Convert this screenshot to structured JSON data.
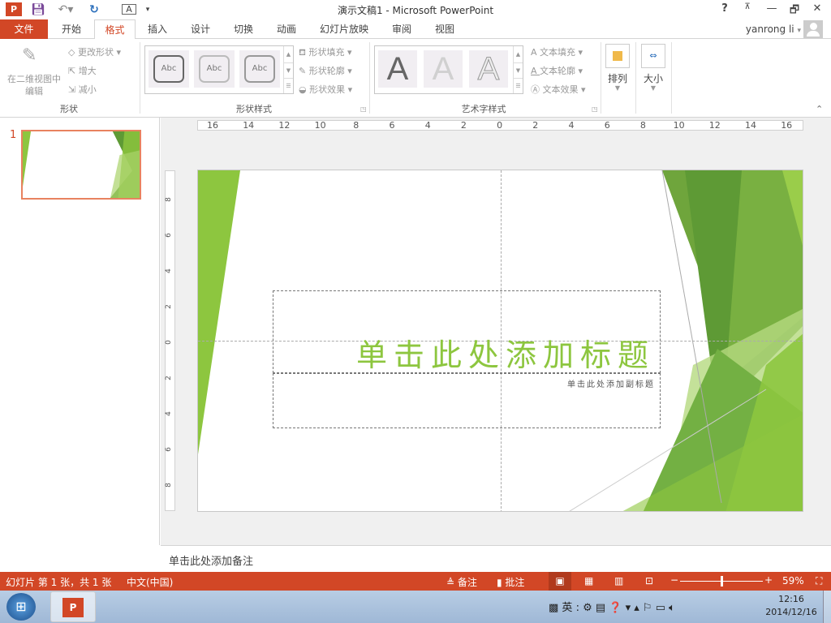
{
  "window": {
    "title": "演示文稿1 - Microsoft PowerPoint",
    "help": "?",
    "restore_ribbon": "⊼",
    "minimize": "—",
    "maximize": "🗗",
    "close": "✕"
  },
  "quick_access": {
    "app_icon": "P",
    "save_icon": "save-icon",
    "undo_icon": "undo-icon",
    "redo_icon": "redo-icon",
    "layout_icon": "layout-icon",
    "customize": "▾"
  },
  "tabs": [
    "文件",
    "开始",
    "格式",
    "插入",
    "设计",
    "切换",
    "动画",
    "幻灯片放映",
    "审阅",
    "视图"
  ],
  "user": {
    "name": "yanrong li",
    "caret": "▾"
  },
  "ribbon": {
    "shape_group": {
      "edit_2d": "在二维视图中编辑",
      "change_shape": "更改形状",
      "enlarge": "增大",
      "shrink": "减小",
      "label": "形状"
    },
    "shape_styles": {
      "samples": [
        "Abc",
        "Abc",
        "Abc"
      ],
      "fill": "形状填充",
      "outline": "形状轮廓",
      "effect": "形状效果",
      "label": "形状样式"
    },
    "wordart": {
      "samples": [
        "A",
        "A",
        "A"
      ],
      "fill": "文本填充",
      "outline": "文本轮廓",
      "effect": "文本效果",
      "label": "艺术字样式"
    },
    "arrange": "排列",
    "size": "大小"
  },
  "thumbnail": {
    "number": "1"
  },
  "ruler": {
    "h": [
      "16",
      "14",
      "12",
      "10",
      "8",
      "6",
      "4",
      "2",
      "0",
      "2",
      "4",
      "6",
      "8",
      "10",
      "12",
      "14",
      "16"
    ],
    "v": [
      "8",
      "6",
      "4",
      "2",
      "0",
      "2",
      "4",
      "6",
      "8"
    ]
  },
  "slide": {
    "title": "单击此处添加标题",
    "subtitle": "单击此处添加副标题",
    "accent": "#8DC63F"
  },
  "notes": {
    "placeholder": "单击此处添加备注"
  },
  "status": {
    "slide_info": "幻灯片 第 1 张，共 1 张",
    "language": "中文(中国)",
    "notes": "备注",
    "comments": "批注",
    "zoom": "59%",
    "zoom_percent": 59
  },
  "taskbar": {
    "ime": "英",
    "time": "12:16",
    "date": "2014/12/16"
  },
  "colors": {
    "brand": "#D24726",
    "green": "#8DC63F"
  }
}
